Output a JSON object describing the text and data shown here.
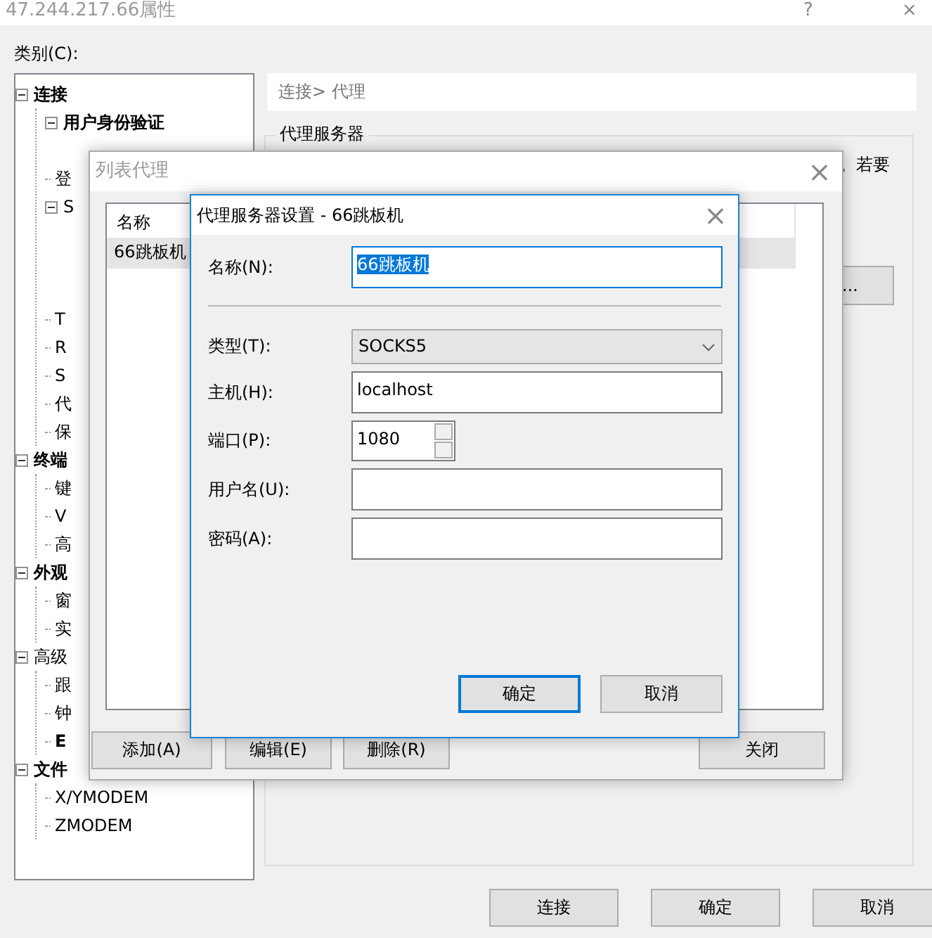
{
  "window": {
    "title": "47.244.217.66属性",
    "help": "?",
    "close": "×"
  },
  "category_label": "类别(C):",
  "tree": [
    {
      "label": "连接",
      "bold": true,
      "expanded": true,
      "children": [
        {
          "label": "用户身份验证",
          "bold": true,
          "expanded": true
        },
        {
          "label": "登",
          "bold": false
        },
        {
          "label": "S",
          "bold": false,
          "expanded": true
        },
        {
          "label": "T",
          "bold": false
        },
        {
          "label": "R",
          "bold": false
        },
        {
          "label": "S",
          "bold": false
        },
        {
          "label": "代",
          "bold": false
        },
        {
          "label": "保",
          "bold": false
        }
      ]
    },
    {
      "label": "终端",
      "bold": true,
      "expanded": true,
      "children": [
        {
          "label": "键",
          "bold": false
        },
        {
          "label": "V",
          "bold": false
        },
        {
          "label": "高",
          "bold": false
        }
      ]
    },
    {
      "label": "外观",
      "bold": true,
      "expanded": true,
      "children": [
        {
          "label": "窗",
          "bold": false
        },
        {
          "label": "实",
          "bold": false
        }
      ]
    },
    {
      "label": "高级",
      "bold": false,
      "expanded": true,
      "children": [
        {
          "label": "跟",
          "bold": false
        },
        {
          "label": "钟",
          "bold": false
        },
        {
          "label": "E",
          "bold": true
        }
      ]
    },
    {
      "label": "文件",
      "bold": true,
      "expanded": true,
      "children": [
        {
          "label": "X/YMODEM",
          "bold": false
        },
        {
          "label": "ZMODEM",
          "bold": false
        }
      ]
    }
  ],
  "breadcrumb": "连接> 代理",
  "group": {
    "title": "代理服务器",
    "text": "。若要",
    "button": "..."
  },
  "buttons": [
    "连接",
    "确定",
    "取消"
  ],
  "list_dialog": {
    "title": "列表代理",
    "close": "×",
    "column": "名称",
    "rows": [
      {
        "name": "66跳板机",
        "selected": true
      }
    ],
    "buttons": [
      "添加(A)",
      "编辑(E)",
      "删除(R)",
      "关闭"
    ]
  },
  "proxy_dialog": {
    "title": "代理服务器设置 - 66跳板机",
    "close": "×",
    "fields": [
      {
        "kind": "text",
        "label": "名称(N):",
        "value": "66跳板机",
        "focused": true
      },
      {
        "kind": "separator"
      },
      {
        "kind": "select",
        "label": "类型(T):",
        "value": "SOCKS5",
        "focused": false
      },
      {
        "kind": "text",
        "label": "主机(H):",
        "value": "localhost",
        "focused": false
      },
      {
        "kind": "spin",
        "label": "端口(P):",
        "value": "1080",
        "focused": false
      },
      {
        "kind": "text",
        "label": "用户名(U):",
        "focused": false
      },
      {
        "kind": "text",
        "label": "密码(A):",
        "focused": false
      }
    ],
    "buttons": [
      {
        "label": "确定",
        "default": true
      },
      {
        "label": "取消",
        "default": false
      }
    ]
  }
}
